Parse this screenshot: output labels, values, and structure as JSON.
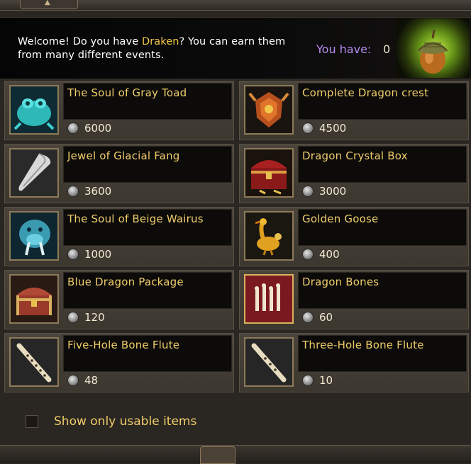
{
  "welcome": {
    "text_before": "Welcome! Do you have ",
    "currency_name": "Draken",
    "text_after": "? You can earn them from many different events.",
    "have_label": "You have:",
    "have_value": "0",
    "currency_icon": "acorn-icon"
  },
  "items": [
    {
      "name": "The Soul of Gray Toad",
      "price": "6000",
      "icon": "toad-soul-icon"
    },
    {
      "name": "Complete Dragon crest",
      "price": "4500",
      "icon": "dragon-crest-icon"
    },
    {
      "name": "Jewel of Glacial Fang",
      "price": "3600",
      "icon": "glacial-fang-icon"
    },
    {
      "name": "Dragon Crystal Box",
      "price": "3000",
      "icon": "treasure-chest-icon"
    },
    {
      "name": "The Soul of Beige Wairus",
      "price": "1000",
      "icon": "walrus-soul-icon"
    },
    {
      "name": "Golden Goose",
      "price": "400",
      "icon": "golden-goose-icon"
    },
    {
      "name": "Blue Dragon Package",
      "price": "120",
      "icon": "treasure-chest-icon"
    },
    {
      "name": "Dragon Bones",
      "price": "60",
      "icon": "dragon-bones-icon"
    },
    {
      "name": "Five-Hole Bone Flute",
      "price": "48",
      "icon": "bone-flute-icon"
    },
    {
      "name": "Three-Hole Bone Flute",
      "price": "10",
      "icon": "bone-flute-icon"
    }
  ],
  "filter": {
    "label": "Show only usable items",
    "checked": false
  },
  "colors": {
    "item_name": "#f0cc6a",
    "currency_highlight": "#f2c64a",
    "have_label": "#b98cf0"
  }
}
